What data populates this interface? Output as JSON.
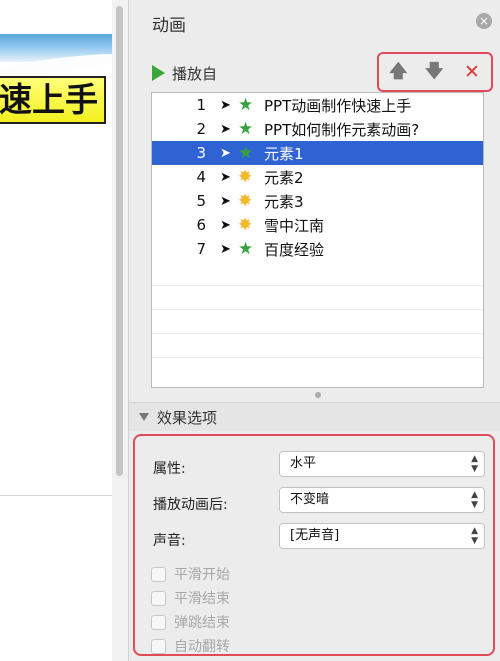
{
  "slide": {
    "title_text": "速上手"
  },
  "panel": {
    "title": "动画",
    "close_glyph": "×",
    "play_label": "播放自",
    "order_up_glyph": "🡅",
    "order_down_glyph": "🡇",
    "delete_glyph": "✕",
    "animations": [
      {
        "num": "1",
        "name": "PPT动画制作快速上手",
        "star": "green",
        "selected": false
      },
      {
        "num": "2",
        "name": "PPT如何制作元素动画?",
        "star": "green",
        "selected": false
      },
      {
        "num": "3",
        "name": "元素1",
        "star": "green",
        "selected": true
      },
      {
        "num": "4",
        "name": "元素2",
        "star": "yellow",
        "selected": false
      },
      {
        "num": "5",
        "name": "元素3",
        "star": "yellow",
        "selected": false
      },
      {
        "num": "6",
        "name": "雪中江南",
        "star": "yellow",
        "selected": false
      },
      {
        "num": "7",
        "name": "百度经验",
        "star": "green",
        "selected": false
      }
    ],
    "effects": {
      "header": "效果选项",
      "property_label": "属性:",
      "property_value": "水平",
      "after_label": "播放动画后:",
      "after_value": "不变暗",
      "sound_label": "声音:",
      "sound_value": "[无声音]",
      "checkboxes": [
        "平滑开始",
        "平滑结束",
        "弹跳结束",
        "自动翻转"
      ]
    }
  },
  "icons": {
    "play": "play-icon",
    "up": "arrow-up-icon",
    "down": "arrow-down-icon",
    "delete": "delete-icon",
    "cursor": "mouse-pointer-icon",
    "star": "star-effect-icon"
  },
  "colors": {
    "accent": "#e04a59",
    "selection": "#2f62d3",
    "green_star": "#3aa141",
    "yellow_star": "#f2b928"
  }
}
